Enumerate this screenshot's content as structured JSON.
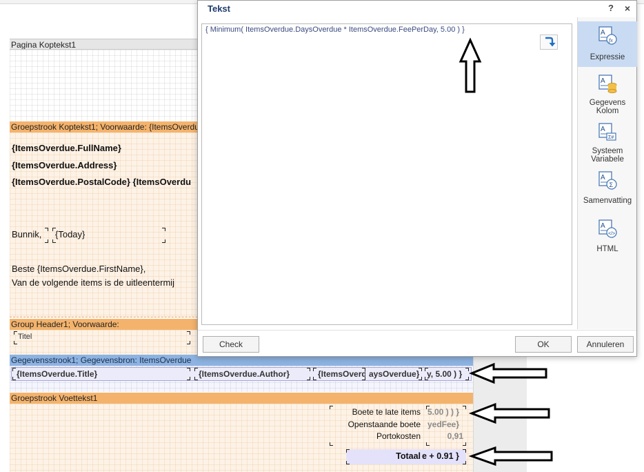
{
  "bands": {
    "page_header": "Pagina Koptekst1",
    "group_header_1": "Groepstrook Koptekst1; Voorwaarde: {ItemsOverdue",
    "group_header_2": "Group Header1; Voorwaarde:",
    "data_band": "Gegevensstrook1; Gegevensbron: ItemsOverdue",
    "group_footer": "Groepstrook Voettekst1"
  },
  "report_texts": {
    "full_name": "{ItemsOverdue.FullName}",
    "address": "{ItemsOverdue.Address}",
    "postal_code": "{ItemsOverdue.PostalCode}  {ItemsOverdu",
    "city": "Bunnik,",
    "today": "{Today}",
    "greeting": "Beste {ItemsOverdue.FirstName},",
    "intro": "Van de volgende items is de uitleentermij",
    "title_header": "Titel"
  },
  "data_row": {
    "title": "{ItemsOverdue.Title}",
    "author": "{ItemsOverdue.Author}",
    "field3": "{ItemsOverd",
    "field4": "aysOverdue}",
    "field5": "y, 5.00 ) }"
  },
  "footer": {
    "late_label": "Boete te late items",
    "late_value": "5.00 ) ) }",
    "open_label": "Openstaande boete",
    "open_value": "yedFee}",
    "postage_label": "Portokosten",
    "postage_value": "0,91",
    "total_label": "Totaal",
    "total_value": "e + 0.91 }"
  },
  "dialog": {
    "title": "Tekst",
    "help": "?",
    "close": "×",
    "expression": "{ Minimum( ItemsOverdue.DaysOverdue * ItemsOverdue.FeePerDay, 5.00 ) }",
    "side_items": [
      {
        "label": "Expressie",
        "icon": "expression-icon",
        "active": true
      },
      {
        "label": "Gegevens Kolom",
        "icon": "data-column-icon",
        "active": false
      },
      {
        "label": "Systeem Variabele",
        "icon": "system-variable-icon",
        "active": false
      },
      {
        "label": "Samenvatting",
        "icon": "summary-icon",
        "active": false
      },
      {
        "label": "HTML",
        "icon": "html-icon",
        "active": false
      }
    ],
    "check_button": "Check",
    "ok_button": "OK",
    "cancel_button": "Annuleren"
  },
  "colors": {
    "band_orange": "#f4b36c",
    "band_blue": "#8db3e2",
    "active_panel": "#c9dbf3",
    "expression_text": "#3a4a80"
  }
}
